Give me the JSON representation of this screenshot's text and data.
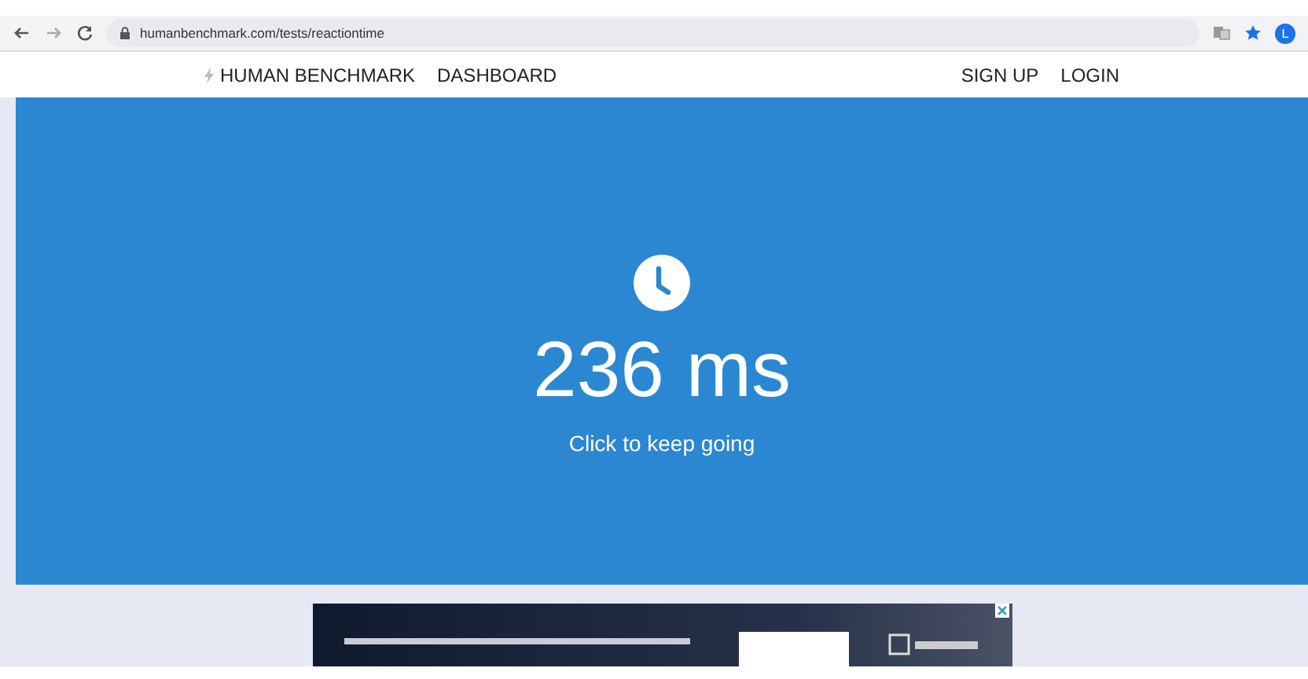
{
  "browser": {
    "url": "humanbenchmark.com/tests/reactiontime",
    "profile_initial": "L"
  },
  "nav": {
    "brand": "HUMAN BENCHMARK",
    "left_links": [
      "DASHBOARD"
    ],
    "right_links": [
      "SIGN UP",
      "LOGIN"
    ]
  },
  "result": {
    "time": "236 ms",
    "hint": "Click to keep going"
  }
}
